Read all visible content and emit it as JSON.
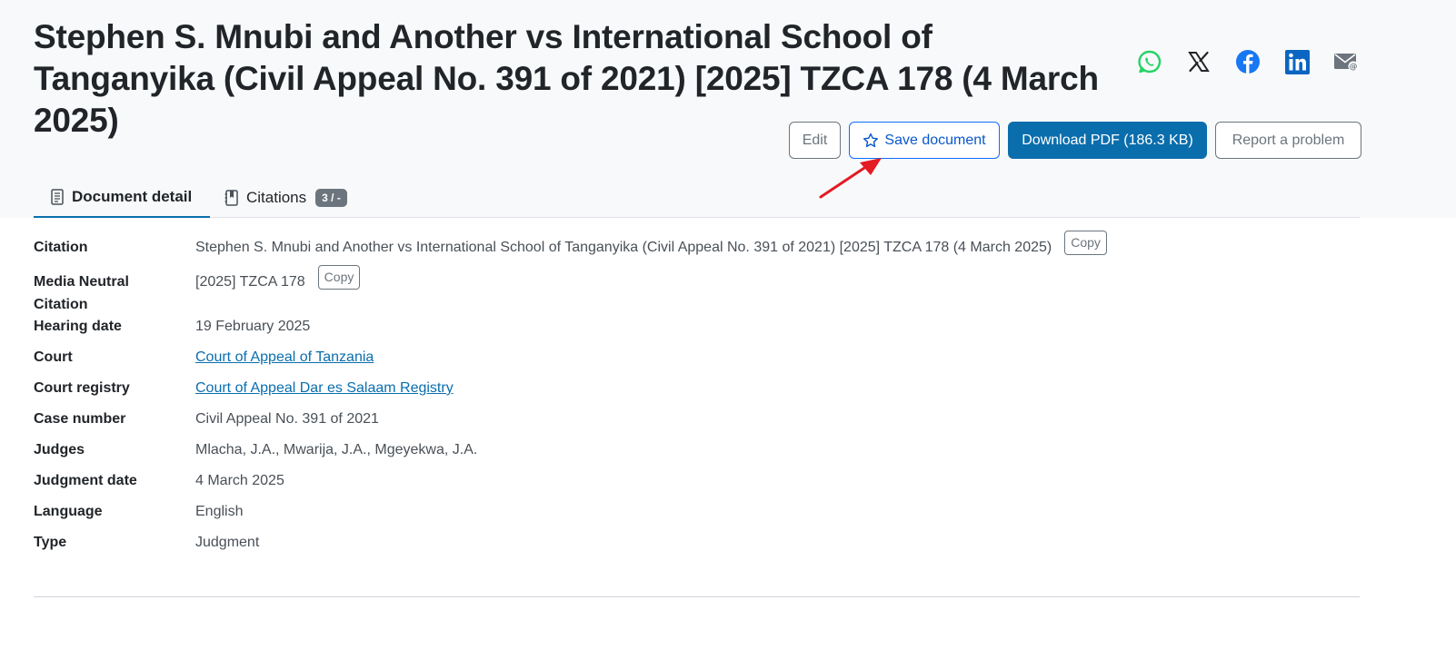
{
  "header": {
    "title": "Stephen S. Mnubi and Another vs International School of Tanganyika (Civil Appeal No. 391 of 2021) [2025] TZCA 178 (4 March 2025)"
  },
  "share": [
    {
      "name": "whatsapp-icon",
      "color": "#25d366"
    },
    {
      "name": "x-icon",
      "color": "#212529"
    },
    {
      "name": "facebook-icon",
      "color": "#1877f2"
    },
    {
      "name": "linkedin-icon",
      "color": "#0a66c2"
    },
    {
      "name": "email-icon",
      "color": "#6c757d"
    }
  ],
  "actions": {
    "edit_label": "Edit",
    "save_label": "Save document",
    "download_label": "Download PDF (186.3 KB)",
    "report_label": "Report a problem"
  },
  "tabs": {
    "detail_label": "Document detail",
    "citations_label": "Citations",
    "citations_badge": "3 / -"
  },
  "details": {
    "copy_label": "Copy",
    "citation": {
      "label": "Citation",
      "value": "Stephen S. Mnubi and Another vs International School of Tanganyika (Civil Appeal No. 391 of 2021) [2025] TZCA 178 (4 March 2025)"
    },
    "media_neutral": {
      "label_line1": "Media Neutral",
      "label_line2": "Citation",
      "value": "[2025] TZCA 178"
    },
    "hearing_date": {
      "label": "Hearing date",
      "value": "19 February 2025"
    },
    "court": {
      "label": "Court",
      "value": "Court of Appeal of Tanzania"
    },
    "court_registry": {
      "label": "Court registry",
      "value": "Court of Appeal Dar es Salaam Registry"
    },
    "case_number": {
      "label": "Case number",
      "value": "Civil Appeal No. 391 of 2021"
    },
    "judges": {
      "label": "Judges",
      "value": "Mlacha, J.A., Mwarija, J.A., Mgeyekwa, J.A."
    },
    "judgment_date": {
      "label": "Judgment date",
      "value": "4 March 2025"
    },
    "language": {
      "label": "Language",
      "value": "English"
    },
    "type": {
      "label": "Type",
      "value": "Judgment"
    }
  },
  "colors": {
    "primary": "#0a6ead",
    "annotation_arrow": "#e31b23"
  }
}
